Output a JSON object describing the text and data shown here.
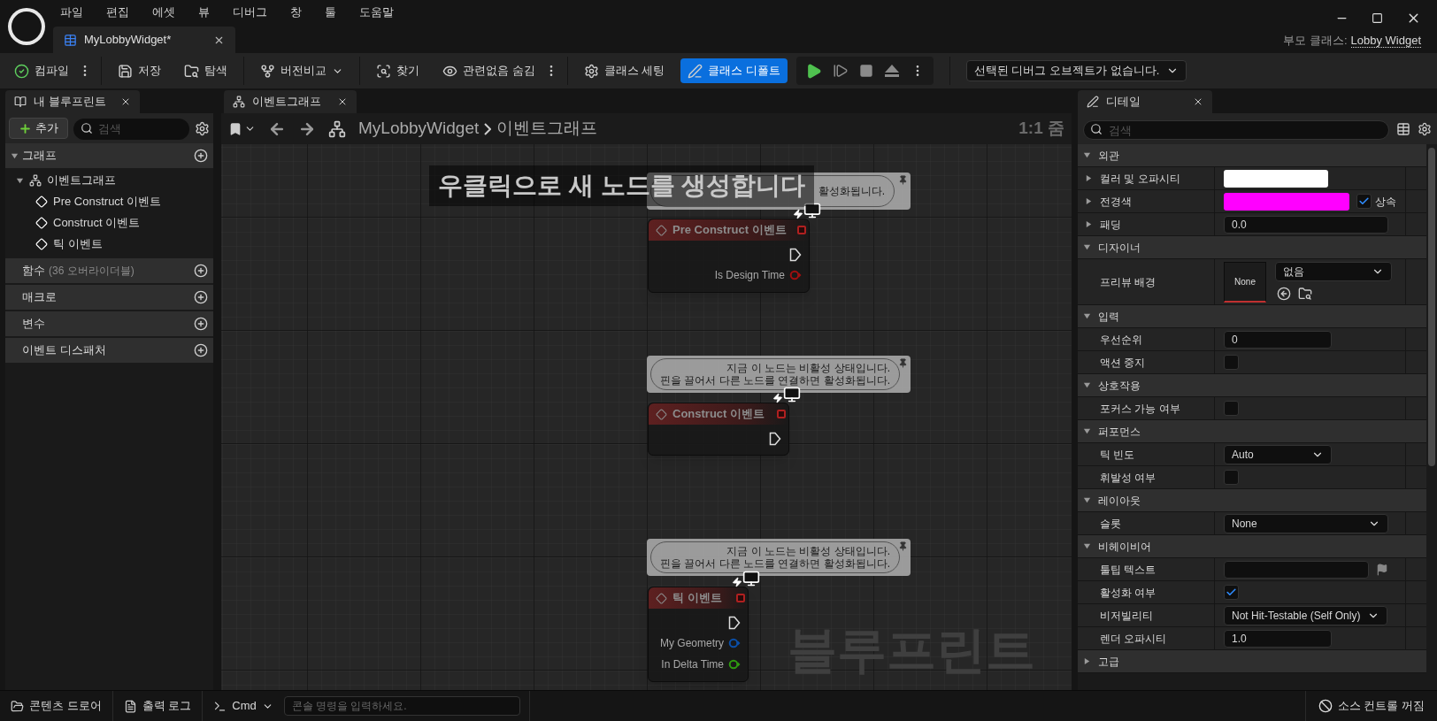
{
  "menu": [
    "파일",
    "편집",
    "에셋",
    "뷰",
    "디버그",
    "창",
    "툴",
    "도움말"
  ],
  "document_tab": {
    "label": "MyLobbyWidget*",
    "selected": true
  },
  "parent_class": {
    "label": "부모 클래스:",
    "value": "Lobby Widget"
  },
  "toolbar": [
    [
      {
        "kind": "button",
        "label": "컴파일",
        "selected": false
      },
      {
        "kind": "more"
      }
    ],
    [
      {
        "kind": "button",
        "label": "저장",
        "selected": false
      },
      {
        "kind": "button",
        "label": "탐색",
        "selected": false
      }
    ],
    [
      {
        "kind": "dropdown",
        "label": "버전비교",
        "selected": false
      }
    ],
    [
      {
        "kind": "button",
        "label": "찾기",
        "selected": false
      },
      {
        "kind": "button",
        "label": "관련없음 숨김",
        "selected": false
      },
      {
        "kind": "more"
      }
    ],
    [
      {
        "kind": "button",
        "label": "클래스 세팅",
        "selected": false
      },
      {
        "kind": "button",
        "label": "클래스 디폴트",
        "selected": true
      }
    ]
  ],
  "debug_object": "선택된 디버그 오브젝트가 없습니다.",
  "my_blueprint": {
    "tab": "내 블루프린트",
    "add": "추가",
    "search_placeholder": "검색",
    "sections": [
      {
        "label": "그래프",
        "expanded": true,
        "children": [
          {
            "label": "이벤트그래프",
            "expanded": true,
            "children": [
              {
                "label": "Pre Construct 이벤트"
              },
              {
                "label": "Construct 이벤트"
              },
              {
                "label": "틱 이벤트"
              }
            ]
          }
        ]
      },
      {
        "label": "함수",
        "note": "(36 오버라이더블)"
      },
      {
        "label": "매크로"
      },
      {
        "label": "변수"
      },
      {
        "label": "이벤트 디스패처"
      }
    ]
  },
  "graph": {
    "tab": "이벤트그래프",
    "breadcrumb": [
      "MyLobbyWidget",
      "이벤트그래프"
    ],
    "zoom": "1:1 줌",
    "hint": "우클릭으로 새 노드를 생성합니다",
    "watermark": "블루프린트",
    "nodes": [
      {
        "title": "Pre Construct 이벤트",
        "comment": [
          "활성화됩니다."
        ],
        "pins": [
          {
            "kind": "exec"
          },
          {
            "kind": "data",
            "label": "Is Design Time",
            "color": "#a01010"
          }
        ]
      },
      {
        "title": "Construct 이벤트",
        "comment": [
          "지금 이 노드는 비활성 상태입니다.",
          "핀을 끌어서 다른 노드를 연결하면 활성화됩니다."
        ],
        "pins": [
          {
            "kind": "exec"
          }
        ]
      },
      {
        "title": "틱 이벤트",
        "comment": [
          "지금 이 노드는 비활성 상태입니다.",
          "핀을 끌어서 다른 노드를 연결하면 활성화됩니다."
        ],
        "pins": [
          {
            "kind": "exec"
          },
          {
            "kind": "data",
            "label": "My Geometry",
            "color": "#0b4fa8"
          },
          {
            "kind": "data",
            "label": "In Delta Time",
            "color": "#2f9a10"
          }
        ]
      }
    ]
  },
  "details": {
    "tab": "디테일",
    "search_placeholder": "검색",
    "categories": [
      {
        "label": "외관",
        "expanded": true,
        "rows": [
          {
            "label": "컬러 및 오파시티",
            "expandable": true,
            "kind": "color",
            "color": "#ffffff"
          },
          {
            "label": "전경색",
            "expandable": true,
            "kind": "color",
            "color": "#ff00ff",
            "checkbox": {
              "label": "상속",
              "checked": true
            }
          },
          {
            "label": "패딩",
            "expandable": true,
            "kind": "margin",
            "value": "0.0"
          }
        ]
      },
      {
        "label": "디자이너",
        "expanded": true,
        "rows": [
          {
            "label": "프리뷰 배경",
            "kind": "brush",
            "value": "None",
            "option": "없음"
          }
        ]
      },
      {
        "label": "입력",
        "expanded": true,
        "rows": [
          {
            "label": "우선순위",
            "kind": "number",
            "value": "0"
          },
          {
            "label": "액션 중지",
            "kind": "checkbox",
            "checked": false
          }
        ]
      },
      {
        "label": "상호작용",
        "expanded": true,
        "rows": [
          {
            "label": "포커스 가능 여부",
            "kind": "checkbox",
            "checked": false
          }
        ]
      },
      {
        "label": "퍼포먼스",
        "expanded": true,
        "rows": [
          {
            "label": "틱 빈도",
            "kind": "dropdown",
            "value": "Auto"
          },
          {
            "label": "휘발성 여부",
            "kind": "checkbox",
            "checked": false
          }
        ]
      },
      {
        "label": "레이아웃",
        "expanded": true,
        "rows": [
          {
            "label": "슬롯",
            "kind": "wide_dropdown",
            "value": "None"
          }
        ]
      },
      {
        "label": "비헤이비어",
        "expanded": true,
        "rows": [
          {
            "label": "툴팁 텍스트",
            "kind": "text"
          },
          {
            "label": "활성화 여부",
            "kind": "checkbox",
            "checked": true
          },
          {
            "label": "비저빌리티",
            "kind": "dropdown",
            "value": "Not Hit-Testable (Self Only)"
          },
          {
            "label": "렌더 오파시티",
            "kind": "number",
            "value": "1.0"
          }
        ]
      },
      {
        "label": "고급",
        "expanded": false
      }
    ]
  },
  "status_bar": {
    "content_drawer": "콘텐츠 드로어",
    "output_log": "출력 로그",
    "cmd": "Cmd",
    "console_placeholder": "콘솔 명령을 입력하세요.",
    "source_control": "소스 컨트롤 꺼짐"
  }
}
